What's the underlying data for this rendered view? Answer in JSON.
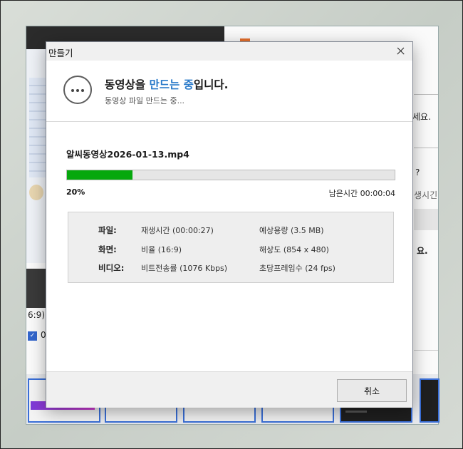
{
  "dialog": {
    "title": "만들기",
    "heading_pre": "동영상을 ",
    "heading_highlight": "만드는 중",
    "heading_post": "입니다.",
    "subheading": "동영상 파일 만드는 중...",
    "filename": "알씨동영상2026-01-13.mp4",
    "progress": {
      "percent_text": "20%",
      "value": 0.2,
      "remaining": "남은시간 00:00:04"
    },
    "info": [
      {
        "label": "파일:",
        "value1": "재생시간 (00:00:27)",
        "value2": "예상용량 (3.5 MB)"
      },
      {
        "label": "화면:",
        "value1": "비율 (16:9)",
        "value2": "해상도 (854 x 480)"
      },
      {
        "label": "비디오:",
        "value1": "비트전송률 (1076 Kbps)",
        "value2": "초당프레임수 (24 fps)"
      }
    ],
    "cancel_label": "취소"
  },
  "background": {
    "partial_texts": [
      "세요.",
      "?",
      "생시긴",
      "요.",
      "6:9)",
      "0"
    ]
  },
  "colors": {
    "progress_fill": "#06a80d",
    "highlight": "#2a7ac9"
  }
}
